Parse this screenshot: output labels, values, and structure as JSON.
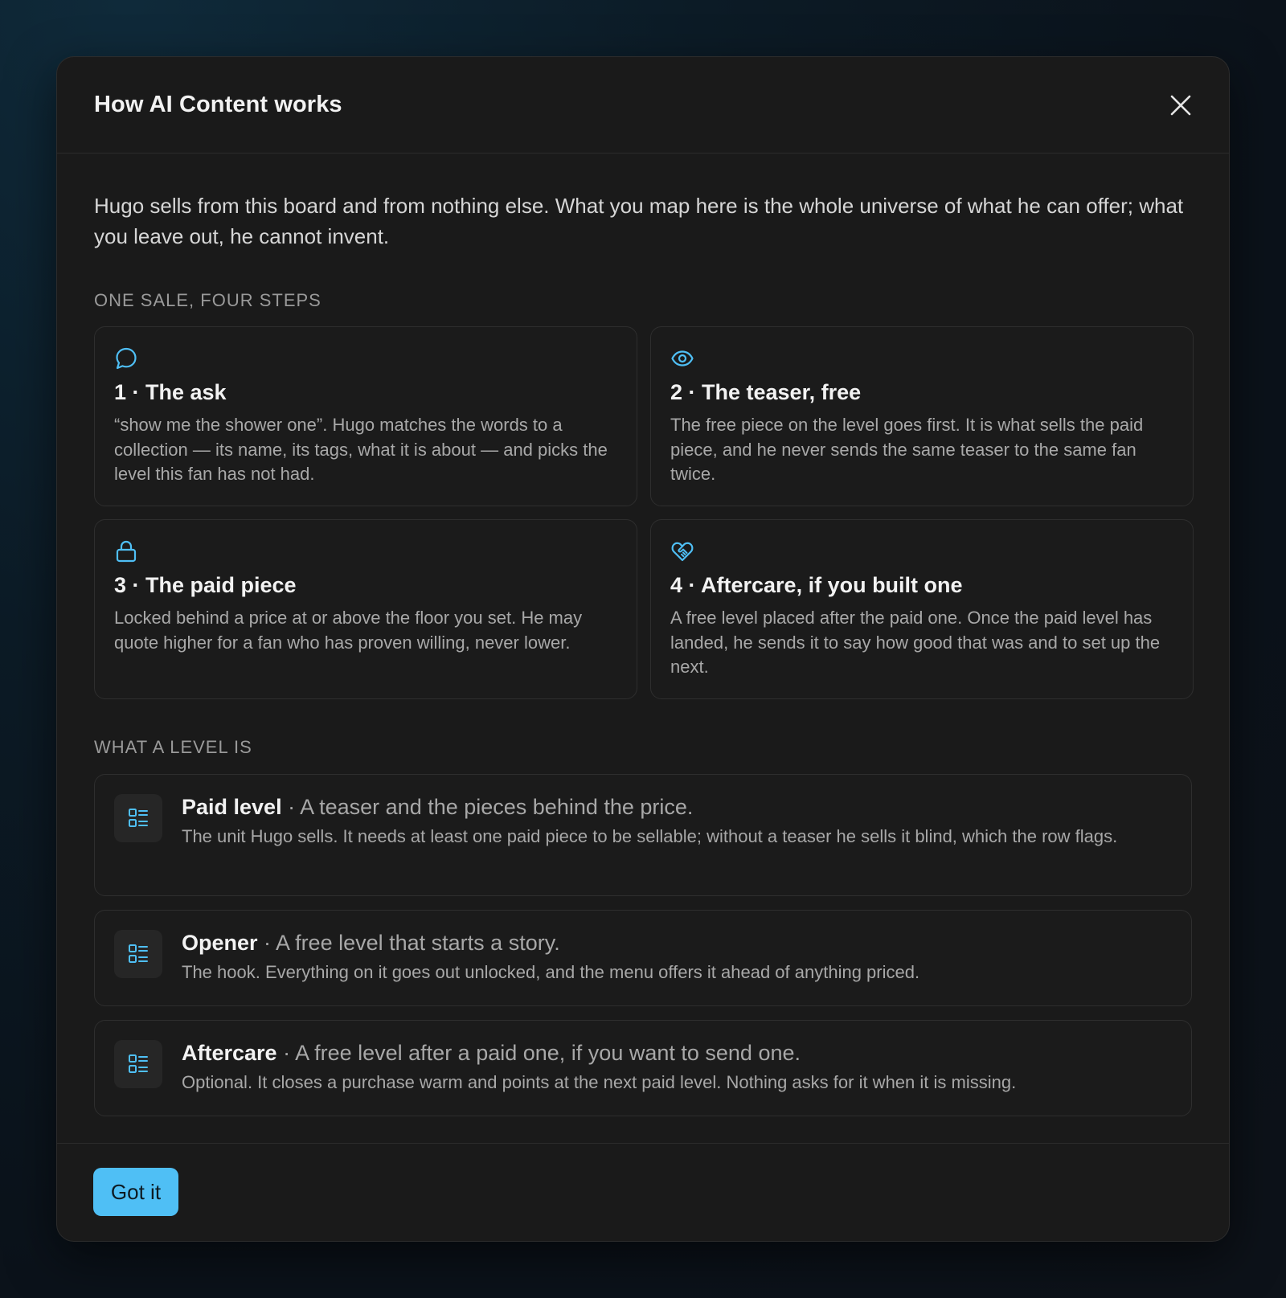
{
  "modal": {
    "title": "How AI Content works",
    "close_icon": "close-icon",
    "intro": "Hugo sells from this board and from nothing else. What you map here is the whole universe of what he can offer; what you leave out, he cannot invent.",
    "accent_color": "#4fbff5"
  },
  "steps_section": {
    "label": "ONE SALE, FOUR STEPS",
    "steps": [
      {
        "icon": "chat-bubble-icon",
        "title": "1 · The ask",
        "text": "“show me the shower one”. Hugo matches the words to a collection — its name, its tags, what it is about — and picks the level this fan has not had."
      },
      {
        "icon": "eye-icon",
        "title": "2 · The teaser, free",
        "text": "The free piece on the level goes first. It is what sells the paid piece, and he never sends the same teaser to the same fan twice."
      },
      {
        "icon": "lock-icon",
        "title": "3 · The paid piece",
        "text": "Locked behind a price at or above the floor you set. He may quote higher for a fan who has proven willing, never lower."
      },
      {
        "icon": "heart-handshake-icon",
        "title": "4 · Aftercare, if you built one",
        "text": "A free level placed after the paid one. Once the paid level has landed, he sends it to say how good that was and to set up the next."
      }
    ]
  },
  "levels_section": {
    "label": "WHAT A LEVEL IS",
    "separator": " · ",
    "levels": [
      {
        "icon": "list-layout-icon",
        "name": "Paid level",
        "summary": "A teaser and the pieces behind the price.",
        "description": "The unit Hugo sells. It needs at least one paid piece to be sellable; without a teaser he sells it blind, which the row flags."
      },
      {
        "icon": "list-layout-icon",
        "name": "Opener",
        "summary": "A free level that starts a story.",
        "description": "The hook. Everything on it goes out unlocked, and the menu offers it ahead of anything priced."
      },
      {
        "icon": "list-layout-icon",
        "name": "Aftercare",
        "summary": "A free level after a paid one, if you want to send one.",
        "description": "Optional. It closes a purchase warm and points at the next paid level. Nothing asks for it when it is missing."
      }
    ]
  },
  "footer": {
    "button_label": "Got it"
  }
}
